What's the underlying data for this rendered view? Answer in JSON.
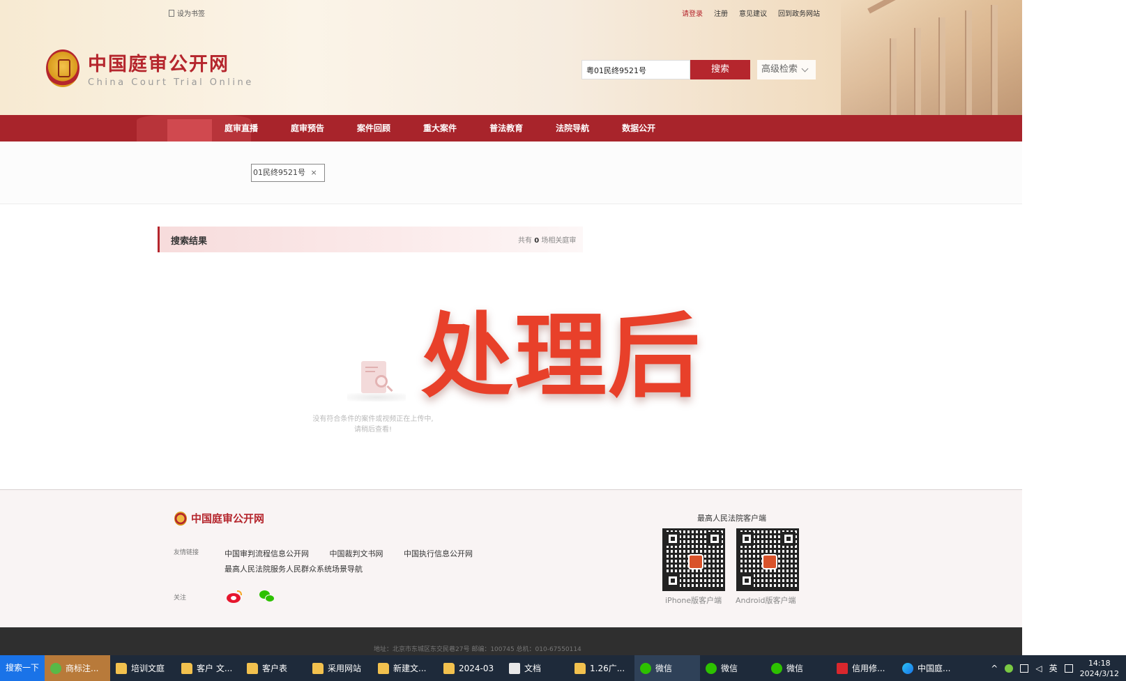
{
  "header": {
    "bookmark": "设为书签",
    "links": {
      "login": "请登录",
      "register": "注册",
      "feedback": "意见建议",
      "gov_site": "回到政务网站"
    },
    "logo": {
      "title": "中国庭审公开网",
      "subtitle": "China Court Trial Online"
    },
    "search": {
      "value": "粤01民终9521号",
      "button": "搜索",
      "advanced": "高级检索"
    }
  },
  "nav": {
    "items": [
      "庭审直播",
      "庭审预告",
      "案件回顾",
      "重大案件",
      "普法教育",
      "法院导航",
      "数据公开"
    ]
  },
  "filter": {
    "tag": "01民终9521号",
    "close": "×"
  },
  "results": {
    "title": "搜索结果",
    "count_prefix": "共有",
    "count": "0",
    "count_suffix": "场相关庭审",
    "empty_line1": "没有符合条件的案件或视频正在上传中,",
    "empty_line2": "请稍后查看!"
  },
  "watermark": "处理后",
  "footer": {
    "logo_title": "中国庭审公开网",
    "friend_label": "友情链接",
    "friend_links": [
      "中国审判流程信息公开网",
      "中国裁判文书网",
      "中国执行信息公开网",
      "最高人民法院服务人民群众系统场景导航"
    ],
    "follow_label": "关注",
    "client_title": "最高人民法院客户端",
    "qr_iphone": "iPhone版客户端",
    "qr_android": "Android版客户端",
    "address": "地址：北京市东城区东交民巷27号    邮编：100745    总机：010-67550114"
  },
  "taskbar": {
    "start": "搜索一下",
    "items": [
      {
        "label": "商标注...",
        "icon": "ie",
        "state": "active"
      },
      {
        "label": "培训文庭",
        "icon": "folder"
      },
      {
        "label": "客户 文...",
        "icon": "folder"
      },
      {
        "label": "客户表",
        "icon": "folder"
      },
      {
        "label": "采用网站",
        "icon": "folder"
      },
      {
        "label": "新建文...",
        "icon": "folder"
      },
      {
        "label": "2024-03",
        "icon": "folder"
      },
      {
        "label": "文档",
        "icon": "doc"
      },
      {
        "label": "1.26广...",
        "icon": "folder"
      },
      {
        "label": "微信",
        "icon": "wechat",
        "state": "hl"
      },
      {
        "label": "微信",
        "icon": "wechat"
      },
      {
        "label": "微信",
        "icon": "wechat"
      },
      {
        "label": "信用修...",
        "icon": "wps"
      },
      {
        "label": "中国庭...",
        "icon": "edge"
      }
    ],
    "ime": "英",
    "time": "14:18",
    "date": "2024/3/12"
  }
}
